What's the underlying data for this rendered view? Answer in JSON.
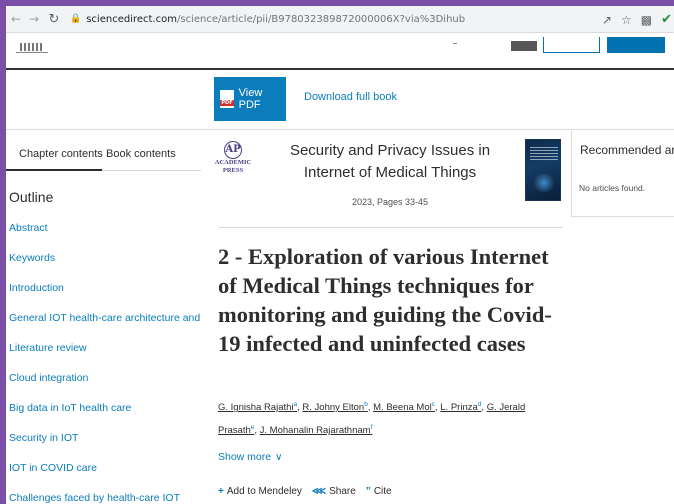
{
  "browser": {
    "url_host": "sciencedirect.com",
    "url_path": "/science/article/pii/B978032389872000006X?via%3Dihub",
    "icons": [
      "back-icon",
      "forward-icon",
      "reload-icon",
      "lock-icon",
      "share-icon",
      "star-icon",
      "extension-icon",
      "check-icon"
    ]
  },
  "toolbar": {
    "view_pdf_label": "View PDF",
    "download_book_label": "Download full book"
  },
  "sidebar": {
    "tabs": [
      {
        "label": "Chapter contents"
      },
      {
        "label": "Book contents"
      }
    ],
    "outline_title": "Outline",
    "items": [
      {
        "label": "Abstract"
      },
      {
        "label": "Keywords"
      },
      {
        "label": "Introduction"
      },
      {
        "label": "General IOT health-care architecture and a..."
      },
      {
        "label": "Literature review"
      },
      {
        "label": "Cloud integration"
      },
      {
        "label": "Big data in IoT health care"
      },
      {
        "label": "Security in IOT"
      },
      {
        "label": "IOT in COVID care"
      },
      {
        "label": "Challenges faced by health-care IOT"
      }
    ]
  },
  "book": {
    "publisher_glyph": "AP",
    "publisher_name_line1": "ACADEMIC",
    "publisher_name_line2": "PRESS",
    "title": "Security and Privacy Issues in Internet of Medical Things",
    "meta": "2023, Pages 33-45"
  },
  "chapter": {
    "title": "2 - Exploration of various Internet of Medical Things techniques for monitoring and guiding the Covid-19 infected and uninfected cases",
    "authors": [
      {
        "name": "G. Ignisha Rajathi",
        "sup": "a"
      },
      {
        "name": "R. Johny Elton",
        "sup": "b"
      },
      {
        "name": "M. Beena Mol",
        "sup": "c"
      },
      {
        "name": "L. Prinza",
        "sup": "d"
      },
      {
        "name": "G. Jerald Prasath",
        "sup": "e"
      },
      {
        "name": "J. Mohanalin Rajarathnam",
        "sup": "f"
      }
    ],
    "show_more_label": "Show more",
    "actions": {
      "mendeley_label": "Add to Mendeley",
      "share_label": "Share",
      "cite_label": "Cite"
    }
  },
  "recommended": {
    "title": "Recommended articles",
    "empty_text": "No articles found."
  },
  "colors": {
    "accent": "#0c7dbb",
    "frame": "#7b4fa8"
  }
}
